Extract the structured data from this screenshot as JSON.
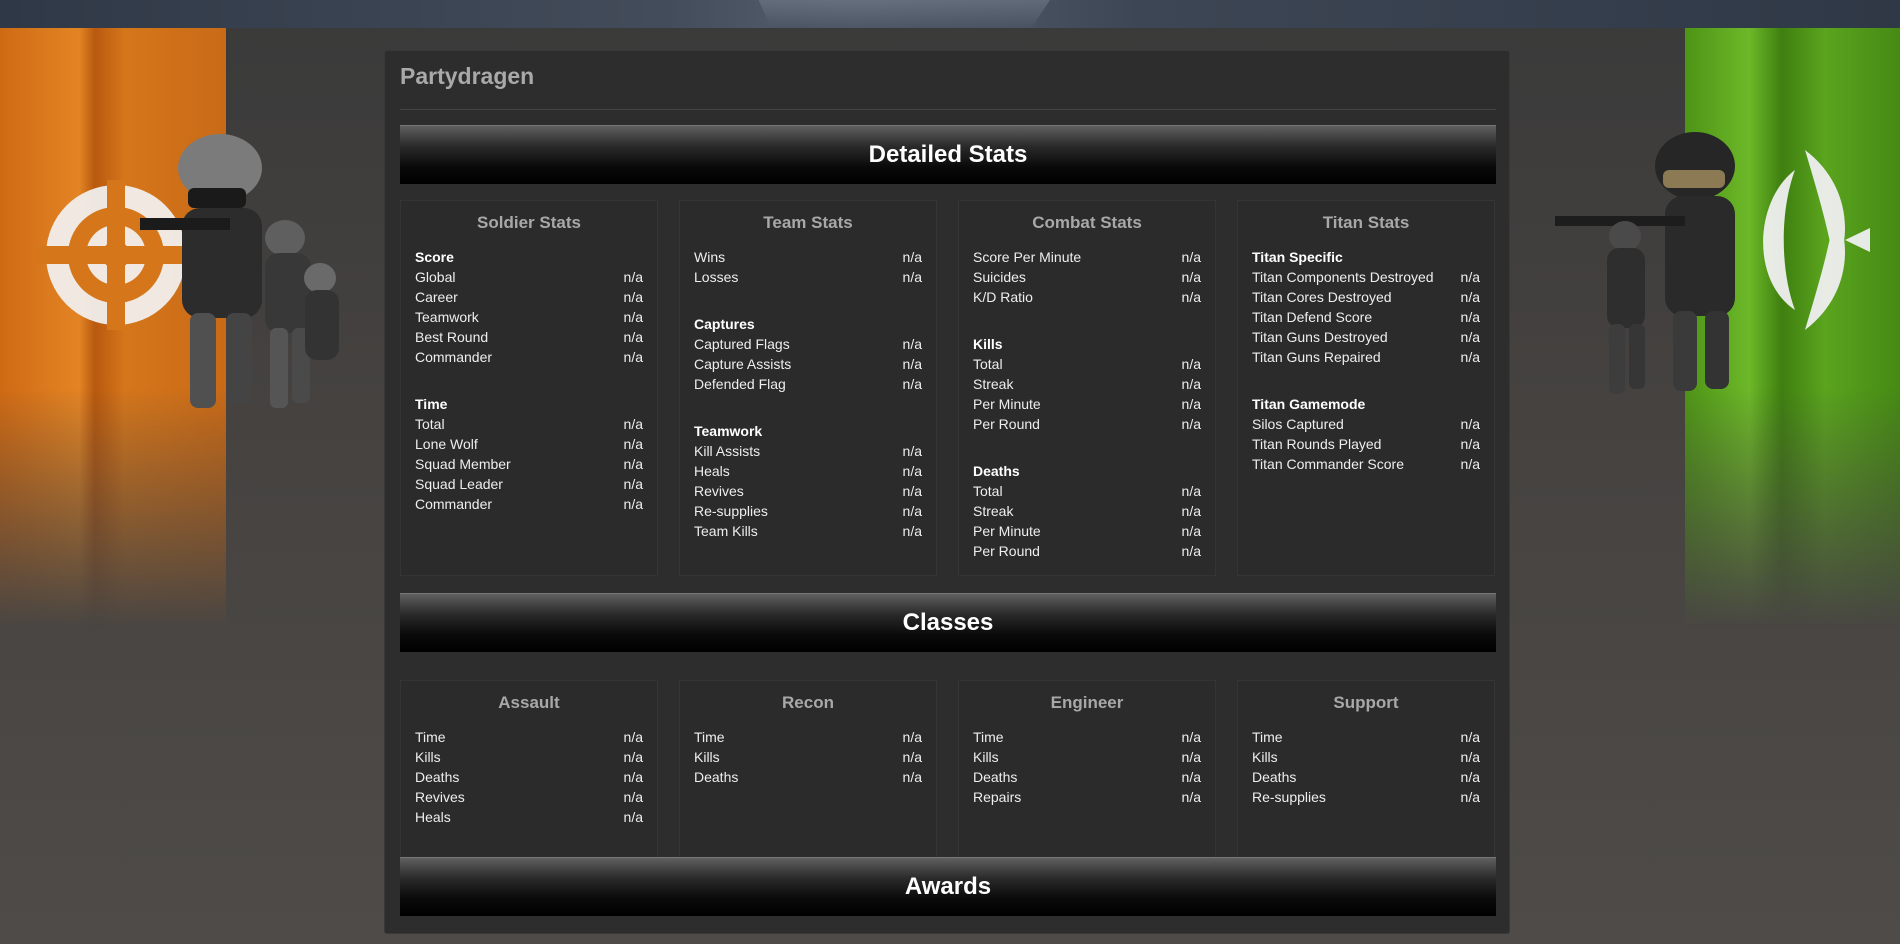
{
  "player": {
    "name": "Partydragen"
  },
  "sections": {
    "detailed": "Detailed Stats",
    "classes": "Classes",
    "awards": "Awards"
  },
  "stats": [
    {
      "title": "Soldier Stats",
      "groups": [
        {
          "title": "Score",
          "rows": [
            {
              "label": "Global",
              "value": "n/a"
            },
            {
              "label": "Career",
              "value": "n/a"
            },
            {
              "label": "Teamwork",
              "value": "n/a"
            },
            {
              "label": "Best Round",
              "value": "n/a"
            },
            {
              "label": "Commander",
              "value": "n/a"
            }
          ]
        },
        {
          "title": "Time",
          "rows": [
            {
              "label": "Total",
              "value": "n/a"
            },
            {
              "label": "Lone Wolf",
              "value": "n/a"
            },
            {
              "label": "Squad Member",
              "value": "n/a"
            },
            {
              "label": "Squad Leader",
              "value": "n/a"
            },
            {
              "label": "Commander",
              "value": "n/a"
            }
          ]
        }
      ]
    },
    {
      "title": "Team Stats",
      "groups": [
        {
          "title": "",
          "rows": [
            {
              "label": "Wins",
              "value": "n/a"
            },
            {
              "label": "Losses",
              "value": "n/a"
            }
          ]
        },
        {
          "title": "Captures",
          "rows": [
            {
              "label": "Captured Flags",
              "value": "n/a"
            },
            {
              "label": "Capture Assists",
              "value": "n/a"
            },
            {
              "label": "Defended Flag",
              "value": "n/a"
            }
          ]
        },
        {
          "title": "Teamwork",
          "rows": [
            {
              "label": "Kill Assists",
              "value": "n/a"
            },
            {
              "label": "Heals",
              "value": "n/a"
            },
            {
              "label": "Revives",
              "value": "n/a"
            },
            {
              "label": "Re-supplies",
              "value": "n/a"
            },
            {
              "label": "Team Kills",
              "value": "n/a"
            }
          ]
        }
      ]
    },
    {
      "title": "Combat Stats",
      "groups": [
        {
          "title": "",
          "rows": [
            {
              "label": "Score Per Minute",
              "value": "n/a"
            },
            {
              "label": "Suicides",
              "value": "n/a"
            },
            {
              "label": "K/D Ratio",
              "value": "n/a"
            }
          ]
        },
        {
          "title": "Kills",
          "rows": [
            {
              "label": "Total",
              "value": "n/a"
            },
            {
              "label": "Streak",
              "value": "n/a"
            },
            {
              "label": "Per Minute",
              "value": "n/a"
            },
            {
              "label": "Per Round",
              "value": "n/a"
            }
          ]
        },
        {
          "title": "Deaths",
          "rows": [
            {
              "label": "Total",
              "value": "n/a"
            },
            {
              "label": "Streak",
              "value": "n/a"
            },
            {
              "label": "Per Minute",
              "value": "n/a"
            },
            {
              "label": "Per Round",
              "value": "n/a"
            }
          ]
        }
      ]
    },
    {
      "title": "Titan Stats",
      "groups": [
        {
          "title": "Titan Specific",
          "rows": [
            {
              "label": "Titan Components Destroyed",
              "value": "n/a"
            },
            {
              "label": "Titan Cores Destroyed",
              "value": "n/a"
            },
            {
              "label": "Titan Defend Score",
              "value": "n/a"
            },
            {
              "label": "Titan Guns Destroyed",
              "value": "n/a"
            },
            {
              "label": "Titan Guns Repaired",
              "value": "n/a"
            }
          ]
        },
        {
          "title": "Titan Gamemode",
          "rows": [
            {
              "label": "Silos Captured",
              "value": "n/a"
            },
            {
              "label": "Titan Rounds Played",
              "value": "n/a"
            },
            {
              "label": "Titan Commander Score",
              "value": "n/a"
            }
          ]
        }
      ]
    }
  ],
  "classes": [
    {
      "title": "Assault",
      "rows": [
        {
          "label": "Time",
          "value": "n/a"
        },
        {
          "label": "Kills",
          "value": "n/a"
        },
        {
          "label": "Deaths",
          "value": "n/a"
        },
        {
          "label": "Revives",
          "value": "n/a"
        },
        {
          "label": "Heals",
          "value": "n/a"
        }
      ]
    },
    {
      "title": "Recon",
      "rows": [
        {
          "label": "Time",
          "value": "n/a"
        },
        {
          "label": "Kills",
          "value": "n/a"
        },
        {
          "label": "Deaths",
          "value": "n/a"
        }
      ]
    },
    {
      "title": "Engineer",
      "rows": [
        {
          "label": "Time",
          "value": "n/a"
        },
        {
          "label": "Kills",
          "value": "n/a"
        },
        {
          "label": "Deaths",
          "value": "n/a"
        },
        {
          "label": "Repairs",
          "value": "n/a"
        }
      ]
    },
    {
      "title": "Support",
      "rows": [
        {
          "label": "Time",
          "value": "n/a"
        },
        {
          "label": "Kills",
          "value": "n/a"
        },
        {
          "label": "Deaths",
          "value": "n/a"
        },
        {
          "label": "Re-supplies",
          "value": "n/a"
        }
      ]
    }
  ],
  "icons": {
    "left_emblem": "pac-faction-emblem-icon",
    "right_emblem": "eu-faction-emblem-icon"
  },
  "colors": {
    "left_banner": "#d5761b",
    "right_banner": "#5aa41e",
    "panel_bg": "#2b2b2b"
  }
}
